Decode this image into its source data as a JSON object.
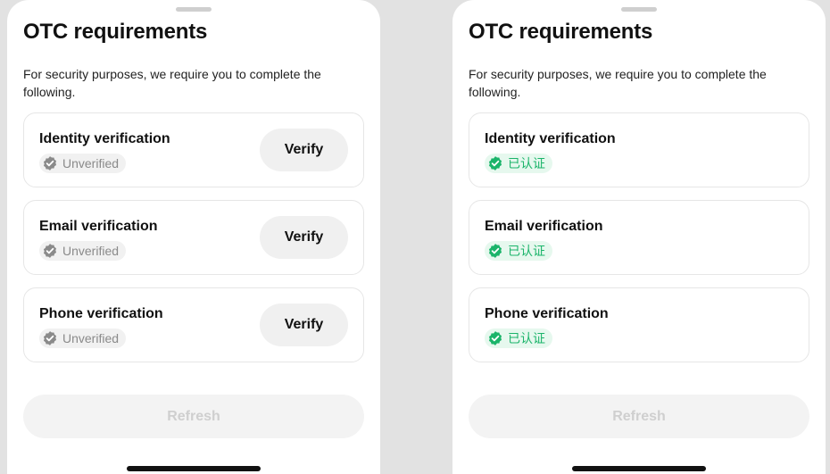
{
  "screens": [
    {
      "title": "OTC requirements",
      "description": "For security purposes, we require you to complete the following.",
      "items": [
        {
          "label": "Identity verification",
          "status": "Unverified",
          "action": "Verify"
        },
        {
          "label": "Email verification",
          "status": "Unverified",
          "action": "Verify"
        },
        {
          "label": "Phone verification",
          "status": "Unverified",
          "action": "Verify"
        }
      ],
      "refresh_label": "Refresh"
    },
    {
      "title": "OTC requirements",
      "description": "For security purposes, we require you to complete the following.",
      "items": [
        {
          "label": "Identity verification",
          "status": "已认证"
        },
        {
          "label": "Email verification",
          "status": "已认证"
        },
        {
          "label": "Phone verification",
          "status": "已认证"
        }
      ],
      "refresh_label": "Refresh"
    }
  ],
  "icons": {
    "badge": "verified-shield-check-icon"
  },
  "colors": {
    "verified_green": "#1bb46a",
    "verified_bg": "#e6f8ee",
    "unverified_gray": "#8a8a8a",
    "unverified_bg": "#f1f1f1"
  }
}
